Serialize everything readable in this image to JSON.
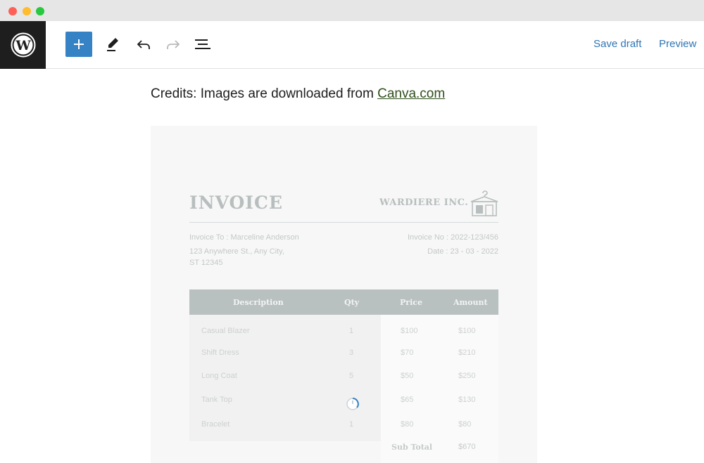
{
  "toolbar": {
    "save_draft": "Save draft",
    "preview": "Preview",
    "accent": "#3582c4"
  },
  "content": {
    "credits_text": "Credits: Images are downloaded from ",
    "credits_link": "Canva.com"
  },
  "invoice": {
    "title": "INVOICE",
    "company": "WARDIERE INC.",
    "invoice_to": "Invoice To : Marceline Anderson",
    "address_line1": "123 Anywhere St., Any City,",
    "address_line2": "ST 12345",
    "invoice_no": "Invoice No : 2022-123/456",
    "date": "Date : 23 - 03 - 2022",
    "columns": [
      "Description",
      "Qty",
      "Price",
      "Amount"
    ],
    "rows": [
      {
        "description": "Casual Blazer",
        "qty": "1",
        "price": "$100",
        "amount": "$100"
      },
      {
        "description": "Shift Dress",
        "qty": "3",
        "price": "$70",
        "amount": "$210"
      },
      {
        "description": "Long Coat",
        "qty": "5",
        "price": "$50",
        "amount": "$250"
      },
      {
        "description": "Tank Top",
        "qty": "",
        "price": "$65",
        "amount": "$130"
      },
      {
        "description": "Bracelet",
        "qty": "1",
        "price": "$80",
        "amount": "$80"
      }
    ],
    "subtotal_label": "Sub Total",
    "subtotal_value": "$670"
  }
}
